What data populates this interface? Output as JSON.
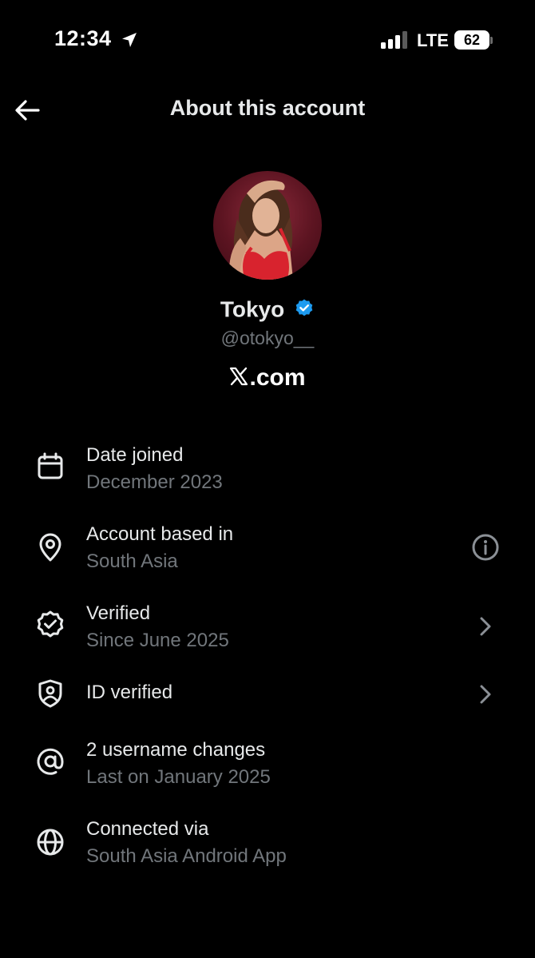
{
  "status_bar": {
    "time": "12:34",
    "network": "LTE",
    "battery": "62"
  },
  "header": {
    "title": "About this account"
  },
  "profile": {
    "name": "Tokyo",
    "handle": "@otokyo__",
    "site": ".com",
    "site_logo": "x-logo-icon"
  },
  "rows": [
    {
      "icon": "calendar-icon",
      "title": "Date joined",
      "subtitle": "December 2023",
      "action": null
    },
    {
      "icon": "location-pin-icon",
      "title": "Account based in",
      "subtitle": "South Asia",
      "action": "info-icon"
    },
    {
      "icon": "verified-badge-icon",
      "title": "Verified",
      "subtitle": "Since June 2025",
      "action": "chevron-right-icon"
    },
    {
      "icon": "id-shield-icon",
      "title": "ID verified",
      "subtitle": "",
      "action": "chevron-right-icon"
    },
    {
      "icon": "at-sign-icon",
      "title": "2 username changes",
      "subtitle": "Last on January 2025",
      "action": null
    },
    {
      "icon": "globe-icon",
      "title": "Connected via",
      "subtitle": "South Asia Android App",
      "action": null
    }
  ],
  "colors": {
    "background": "#000000",
    "text_primary": "#e7e9ea",
    "text_secondary": "#71767b",
    "verified_blue": "#1d9bf0"
  }
}
